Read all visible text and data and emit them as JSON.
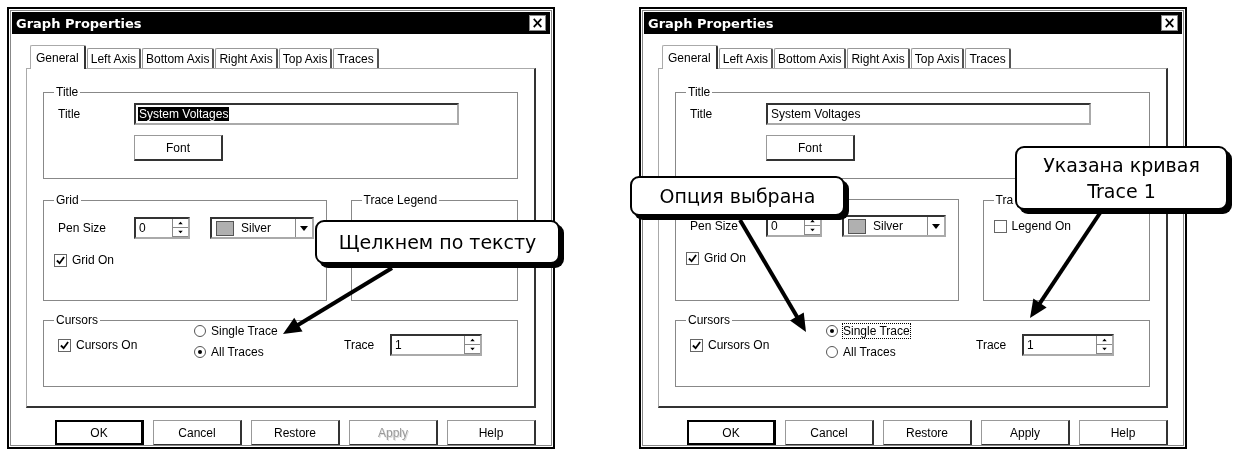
{
  "dialogs": [
    {
      "title": "Graph Properties",
      "close": "×",
      "tabs": [
        {
          "label": "General",
          "selected": true
        },
        {
          "label": "Left Axis",
          "selected": false
        },
        {
          "label": "Bottom Axis",
          "selected": false
        },
        {
          "label": "Right Axis",
          "selected": false
        },
        {
          "label": "Top Axis",
          "selected": false
        },
        {
          "label": "Traces",
          "selected": false
        }
      ],
      "title_group": {
        "legend": "Title",
        "label": "Title",
        "value": "System Voltages",
        "value_selected": true,
        "font_button": "Font"
      },
      "grid_group": {
        "legend": "Grid",
        "pen_size_label": "Pen Size",
        "pen_size": "0",
        "color_name": "Silver",
        "grid_on": {
          "label": "Grid On",
          "checked": true
        }
      },
      "legend_group": {
        "legend": "Trace Legend"
      },
      "cursors": {
        "legend": "Cursors",
        "cursors_on": {
          "label": "Cursors On",
          "checked": true
        },
        "radios": [
          {
            "label": "Single Trace",
            "selected": false,
            "focused": false
          },
          {
            "label": "All Traces",
            "selected": true,
            "focused": false
          }
        ],
        "trace_label": "Trace",
        "trace": "1"
      },
      "buttons": [
        {
          "label": "OK",
          "default": true,
          "disabled": false
        },
        {
          "label": "Cancel",
          "default": false,
          "disabled": false
        },
        {
          "label": "Restore",
          "default": false,
          "disabled": false
        },
        {
          "label": "Apply",
          "default": false,
          "disabled": true
        },
        {
          "label": "Help",
          "default": false,
          "disabled": false
        }
      ]
    },
    {
      "title": "Graph Properties",
      "close": "×",
      "tabs": [
        {
          "label": "General",
          "selected": true
        },
        {
          "label": "Left Axis",
          "selected": false
        },
        {
          "label": "Bottom Axis",
          "selected": false
        },
        {
          "label": "Right Axis",
          "selected": false
        },
        {
          "label": "Top Axis",
          "selected": false
        },
        {
          "label": "Traces",
          "selected": false
        }
      ],
      "title_group": {
        "legend": "Title",
        "label": "Title",
        "value": "System Voltages",
        "value_selected": false,
        "font_button": "Font"
      },
      "grid_group": {
        "pen_size_label": "Pen Size",
        "pen_size": "0",
        "color_name": "Silver",
        "grid_on": {
          "label": "Grid On",
          "checked": true
        }
      },
      "legend_group": {
        "legend": "Tra",
        "legend_on": {
          "label": "Legend On",
          "checked": false
        }
      },
      "cursors": {
        "legend": "Cursors",
        "cursors_on": {
          "label": "Cursors On",
          "checked": true
        },
        "radios": [
          {
            "label": "Single Trace",
            "selected": true,
            "focused": true
          },
          {
            "label": "All Traces",
            "selected": false,
            "focused": false
          }
        ],
        "trace_label": "Trace",
        "trace": "1"
      },
      "buttons": [
        {
          "label": "OK",
          "default": true,
          "disabled": false
        },
        {
          "label": "Cancel",
          "default": false,
          "disabled": false
        },
        {
          "label": "Restore",
          "default": false,
          "disabled": false
        },
        {
          "label": "Apply",
          "default": false,
          "disabled": false
        },
        {
          "label": "Help",
          "default": false,
          "disabled": false
        }
      ]
    }
  ],
  "callouts": [
    {
      "text": "Щелкнем по тексту"
    },
    {
      "text": "Опция выбрана"
    },
    {
      "text": "Указана кривая\nTrace 1"
    }
  ]
}
